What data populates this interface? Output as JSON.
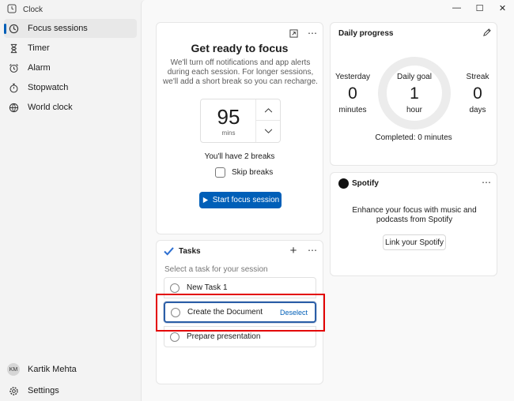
{
  "app": {
    "title": "Clock"
  },
  "window": {
    "minimize": "—",
    "maximize": "☐",
    "close": "✕"
  },
  "sidebar": {
    "items": [
      {
        "label": "Focus sessions",
        "icon": "focus-icon",
        "active": true
      },
      {
        "label": "Timer",
        "icon": "hourglass-icon"
      },
      {
        "label": "Alarm",
        "icon": "alarm-icon"
      },
      {
        "label": "Stopwatch",
        "icon": "stopwatch-icon"
      },
      {
        "label": "World clock",
        "icon": "globe-icon"
      }
    ],
    "user": {
      "initials": "KM",
      "name": "Kartik Mehta"
    },
    "settings_label": "Settings"
  },
  "focus": {
    "title": "Get ready to focus",
    "description": "We'll turn off notifications and app alerts during each session. For longer sessions, we'll add a short break so you can recharge.",
    "timer_value": "95",
    "timer_unit": "mins",
    "breaks_text": "You'll have 2 breaks",
    "skip_label": "Skip breaks",
    "start_label": "Start focus session"
  },
  "tasks": {
    "title": "Tasks",
    "subtitle": "Select a task for your session",
    "items": [
      {
        "label": "New Task 1"
      },
      {
        "label": "Create the Document",
        "selected": true
      },
      {
        "label": "Prepare presentation"
      }
    ],
    "deselect_label": "Deselect"
  },
  "progress": {
    "title": "Daily progress",
    "yesterday": {
      "label": "Yesterday",
      "value": "0",
      "unit": "minutes"
    },
    "goal": {
      "label": "Daily goal",
      "value": "1",
      "unit": "hour"
    },
    "streak": {
      "label": "Streak",
      "value": "0",
      "unit": "days"
    },
    "completed": "Completed: 0 minutes"
  },
  "spotify": {
    "name": "Spotify",
    "description": "Enhance your focus with music and podcasts from Spotify",
    "link_label": "Link your Spotify"
  },
  "colors": {
    "accent": "#005fb8",
    "highlight": "#e30000"
  }
}
